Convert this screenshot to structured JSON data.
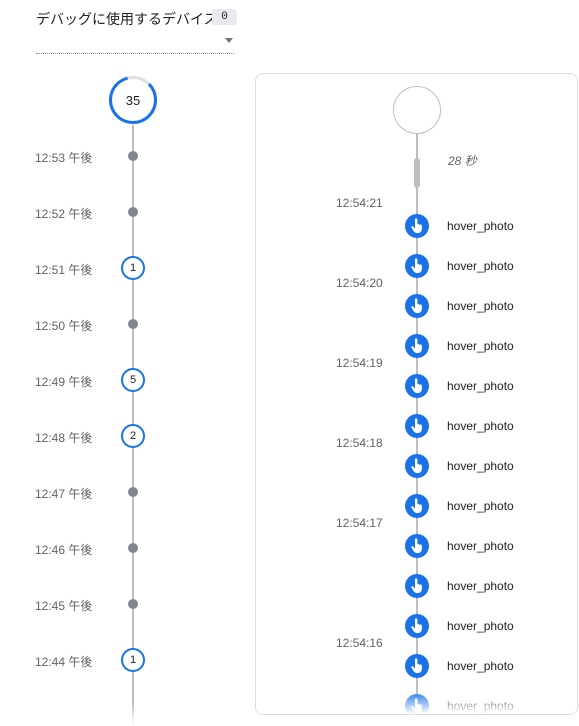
{
  "header": {
    "title": "デバッグに使用するデバイス",
    "device_count": "0"
  },
  "timeline": {
    "total_events": "35",
    "rows": [
      {
        "time": "12:53 午後",
        "count": ""
      },
      {
        "time": "12:52 午後",
        "count": ""
      },
      {
        "time": "12:51 午後",
        "count": "1"
      },
      {
        "time": "12:50 午後",
        "count": ""
      },
      {
        "time": "12:49 午後",
        "count": "5"
      },
      {
        "time": "12:48 午後",
        "count": "2"
      },
      {
        "time": "12:47 午後",
        "count": ""
      },
      {
        "time": "12:46 午後",
        "count": ""
      },
      {
        "time": "12:45 午後",
        "count": ""
      },
      {
        "time": "12:44 午後",
        "count": "1"
      }
    ]
  },
  "event_panel": {
    "gap_label": "28 秒",
    "timestamps": [
      "12:54:21",
      "12:54:20",
      "12:54:19",
      "12:54:18",
      "12:54:17",
      "12:54:16"
    ],
    "events": [
      "hover_photo",
      "hover_photo",
      "hover_photo",
      "hover_photo",
      "hover_photo",
      "hover_photo",
      "hover_photo",
      "hover_photo",
      "hover_photo",
      "hover_photo",
      "hover_photo",
      "hover_photo",
      "hover_photo"
    ],
    "event_icon": "touch-hand-icon",
    "accent_color": "#1a73e8"
  }
}
